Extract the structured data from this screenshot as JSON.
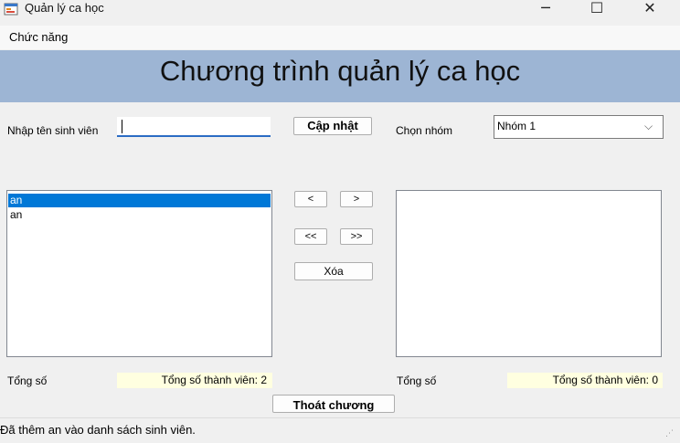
{
  "window": {
    "title": "Quản lý ca học",
    "app_icon": "windows-form-icon",
    "controls": {
      "minimize": "─",
      "maximize": "☐",
      "close": "✕"
    }
  },
  "menu": {
    "items": [
      "Chức năng"
    ]
  },
  "header": {
    "title": "Chương trình quản lý ca học",
    "background": "#9db5d4"
  },
  "student_input": {
    "label": "Nhập tên sinh viên",
    "value": ""
  },
  "buttons": {
    "update": "Cập nhật",
    "move_left": "<",
    "move_right": ">",
    "move_all_left": "<<",
    "move_all_right": ">>",
    "delete": "Xóa",
    "exit": "Thoát chương"
  },
  "group": {
    "label": "Chọn nhóm",
    "selected": "Nhóm 1",
    "arrow": "⌵"
  },
  "left_list": {
    "items": [
      "an",
      "an"
    ],
    "selected_index": 0,
    "selection_color": "#0078d7"
  },
  "right_list": {
    "items": []
  },
  "totals": {
    "left_label": "Tổng số",
    "left_value": "Tổng số thành viên: 2",
    "right_label": "Tổng số",
    "right_value": "Tổng số thành viên: 0",
    "background": "#ffffe0"
  },
  "status": {
    "text": "Đã thêm an vào danh sách sinh viên.",
    "grip": "⋰"
  }
}
